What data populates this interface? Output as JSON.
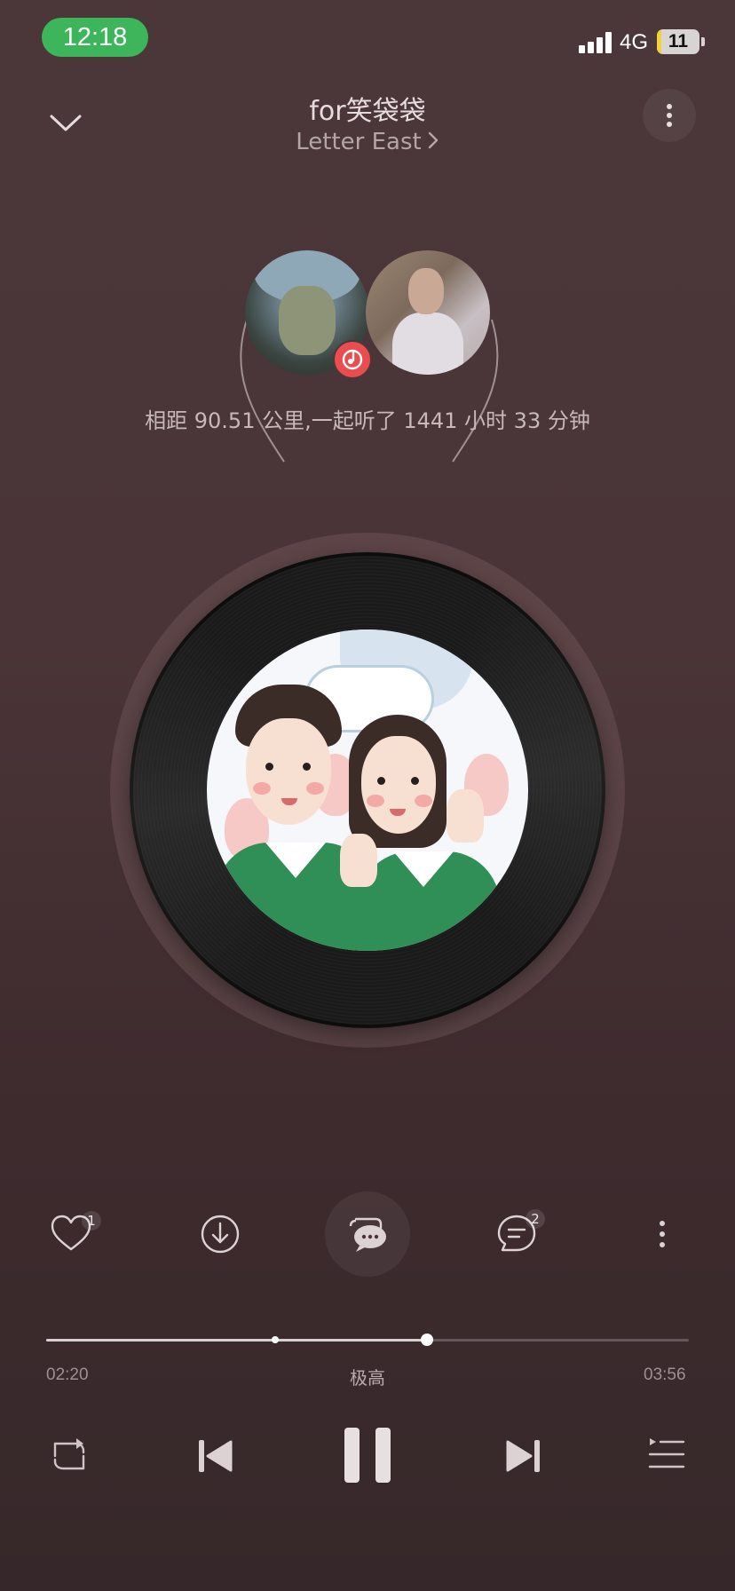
{
  "status_bar": {
    "time": "12:18",
    "network": "4G",
    "battery": "11",
    "battery_level": 0.11
  },
  "header": {
    "title": "for笑袋袋",
    "artist": "Letter East"
  },
  "together": {
    "text": "相距 90.51 公里,一起听了 1441 小时 33 分钟"
  },
  "actions": {
    "like_count": "1",
    "comment_count": "2"
  },
  "progress": {
    "current": "02:20",
    "total": "03:56",
    "quality": "极高",
    "played_fraction": 0.593
  },
  "colors": {
    "background": "#4a3437",
    "status_time_pill": "#3db55a",
    "music_badge": "#e94d4d",
    "battery_fill": "#f2d03a"
  },
  "icons": {
    "collapse": "chevron-down-icon",
    "more_top": "more-vertical-icon",
    "like": "heart-icon",
    "download": "download-icon",
    "chat": "chat-bubbles-icon",
    "comments": "comment-icon",
    "more_actions": "more-vertical-icon",
    "repeat": "repeat-icon",
    "previous": "previous-icon",
    "pause": "pause-icon",
    "next": "next-icon",
    "playlist": "playlist-icon"
  }
}
